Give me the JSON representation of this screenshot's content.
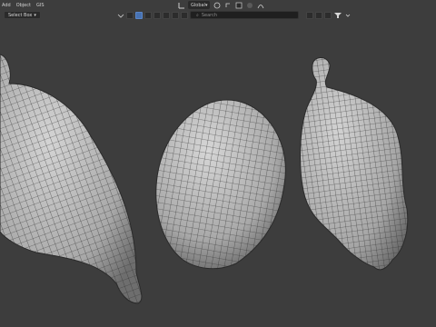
{
  "menu": [
    "Add",
    "Object",
    "GIS"
  ],
  "header": {
    "transform_orientation": "Global",
    "select_mode": "Select Box"
  },
  "outliner": {
    "search_placeholder": "Search"
  },
  "colors": {
    "background": "#3d3d3d",
    "mesh_fill": "#b8b8b8",
    "wire": "#2b2b2b",
    "accent": "#4772b3"
  },
  "viewport": {
    "objects": [
      "mesh-left",
      "mesh-center",
      "mesh-right"
    ]
  }
}
